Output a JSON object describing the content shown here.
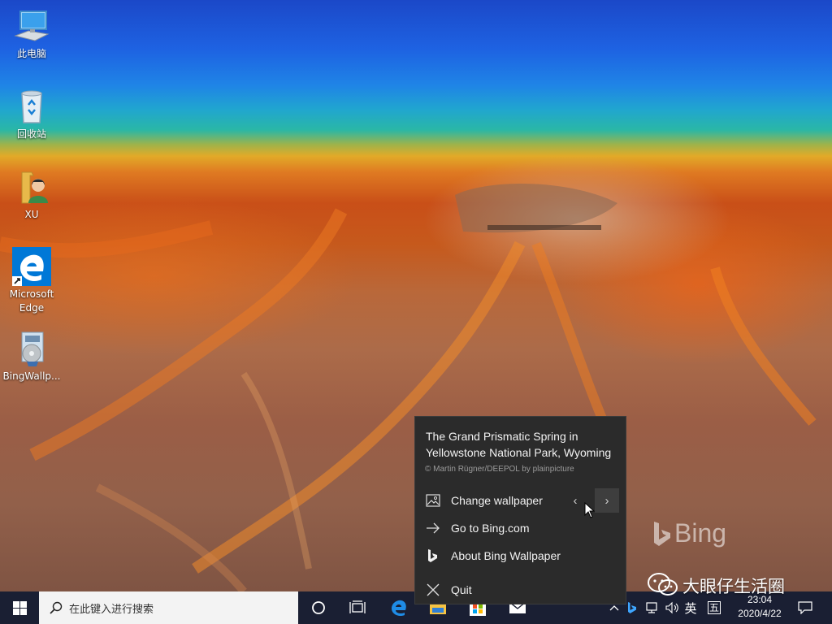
{
  "desktop": {
    "icons": [
      {
        "label": "此电脑",
        "icon": "this-pc-icon"
      },
      {
        "label": "回收站",
        "icon": "recycle-bin-icon"
      },
      {
        "label": "XU",
        "icon": "user-folder-icon"
      },
      {
        "label": "Microsoft\nEdge",
        "line1": "Microsoft",
        "line2": "Edge",
        "icon": "edge-icon"
      },
      {
        "label": "BingWallp...",
        "icon": "bing-wallpaper-installer-icon"
      }
    ],
    "watermark": "Bing"
  },
  "popup": {
    "title": "The Grand Prismatic Spring in Yellowstone National Park, Wyoming",
    "credit": "© Martin Rügner/DEEPOL by plainpicture",
    "items": [
      {
        "label": "Change wallpaper",
        "icon": "image-icon"
      },
      {
        "label": "Go to Bing.com",
        "icon": "arrow-right-icon"
      },
      {
        "label": "About Bing Wallpaper",
        "icon": "bing-logo-icon"
      },
      {
        "label": "Quit",
        "icon": "close-icon"
      }
    ],
    "prev_glyph": "‹",
    "next_glyph": "›"
  },
  "taskbar": {
    "search_placeholder": "在此键入进行搜索",
    "ime_lang": "英",
    "ime_mode": "五",
    "time": "23:04",
    "date": "2020/4/22"
  },
  "overlay_watermark": "大眼仔生活圈",
  "colors": {
    "taskbar": "#1a1f33",
    "popup_bg": "#2b2b2b",
    "edge_blue": "#0078d7"
  }
}
